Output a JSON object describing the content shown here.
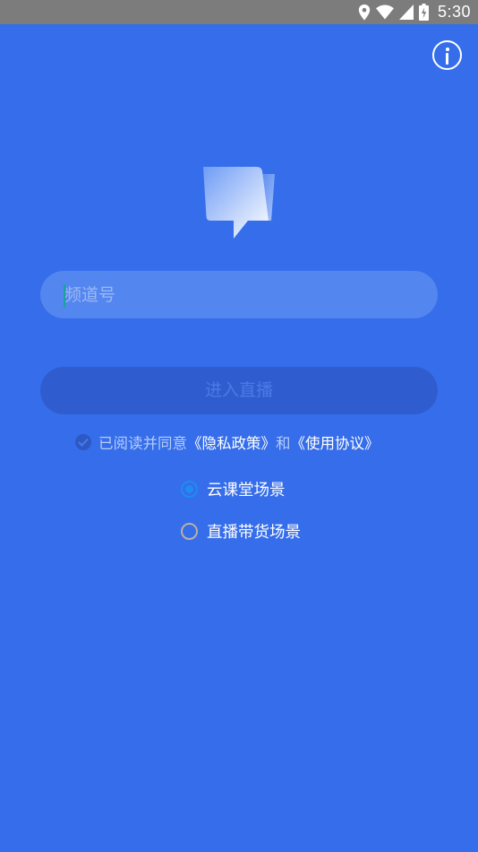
{
  "status_bar": {
    "time": "5:30",
    "icons": [
      "location-icon",
      "wifi-icon",
      "signal-icon",
      "battery-icon"
    ]
  },
  "header": {
    "info_icon": "info-icon"
  },
  "logo": {
    "icon": "chat-bubble-logo"
  },
  "channel": {
    "placeholder": "频道号",
    "value": ""
  },
  "enter_button": {
    "label": "进入直播",
    "enabled": false
  },
  "agreement": {
    "checked": true,
    "prefix": "已阅读并同意",
    "privacy_link": "《隐私政策》",
    "conjunction": "和",
    "terms_link": "《使用协议》"
  },
  "scenes": [
    {
      "label": "云课堂场景",
      "selected": true
    },
    {
      "label": "直播带货场景",
      "selected": false
    }
  ],
  "colors": {
    "background": "#356dea",
    "status_bar": "#7c7c7c",
    "input_bg": "#5486f0",
    "button_disabled_bg": "#2f5dcf",
    "radio_selected": "#1f8cf2"
  }
}
